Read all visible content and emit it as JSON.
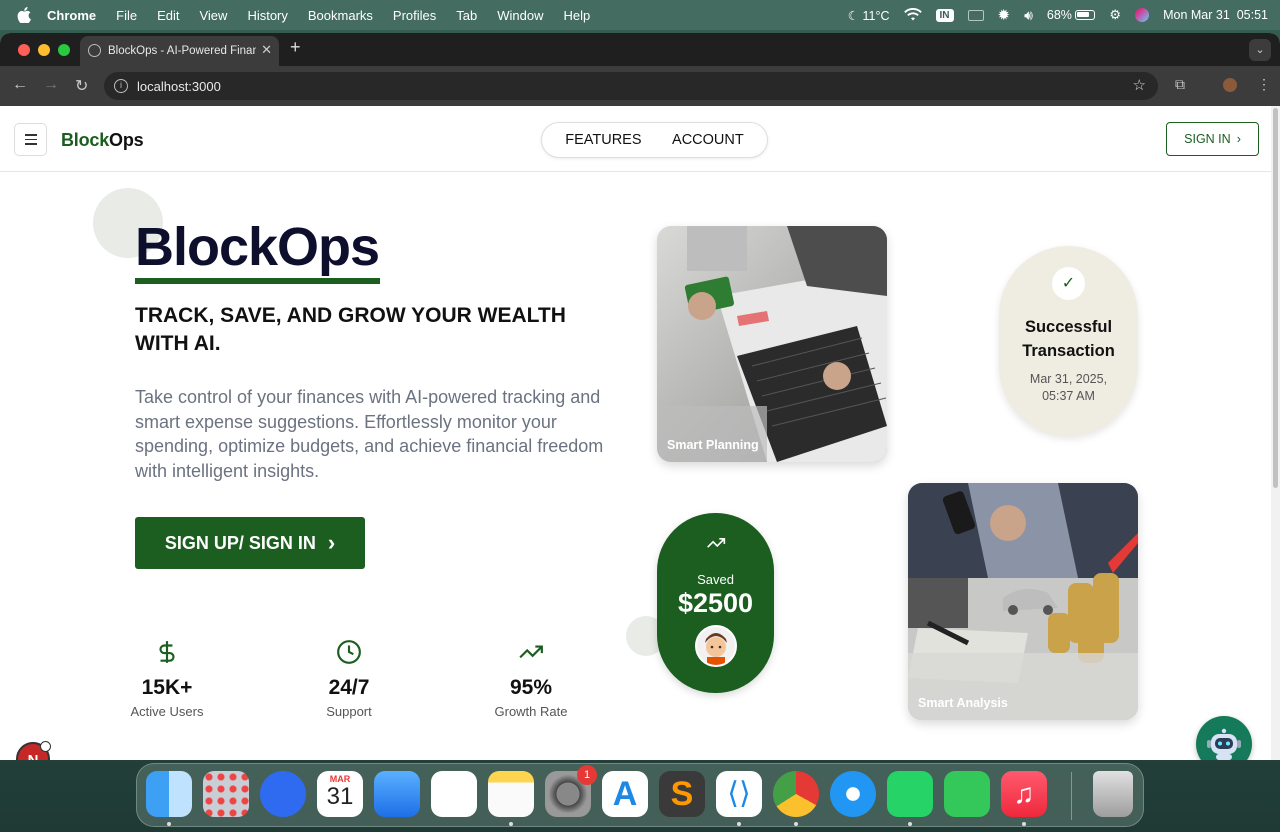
{
  "menubar": {
    "app_name": "Chrome",
    "items": [
      "File",
      "Edit",
      "View",
      "History",
      "Bookmarks",
      "Profiles",
      "Tab",
      "Window",
      "Help"
    ],
    "weather": "11°C",
    "input_source": "IN",
    "battery": "68%",
    "clock": "Mon Mar 31  05:51"
  },
  "browser": {
    "tab_title": "BlockOps - AI-Powered Finan",
    "url": "localhost:3000"
  },
  "site": {
    "logo_block": "Block",
    "logo_ops": "Ops",
    "nav": [
      "FEATURES",
      "ACCOUNT"
    ],
    "signin_label": "SIGN IN"
  },
  "hero": {
    "title": "BlockOps",
    "subtitle": "TRACK, SAVE, AND GROW YOUR WEALTH WITH AI.",
    "description": "Take control of your finances with AI-powered tracking and smart expense suggestions. Effortlessly monitor your spending, optimize budgets, and achieve financial freedom with intelligent insights.",
    "cta": "SIGN UP/ SIGN IN"
  },
  "stats": [
    {
      "value": "15K+",
      "label": "Active Users",
      "icon": "dollar-icon"
    },
    {
      "value": "24/7",
      "label": "Support",
      "icon": "clock-icon"
    },
    {
      "value": "95%",
      "label": "Growth Rate",
      "icon": "trending-up-icon"
    }
  ],
  "cards": {
    "planning_caption": "Smart Planning",
    "analysis_caption": "Smart Analysis",
    "success_title": "Successful Transaction",
    "success_date": "Mar 31, 2025, 05:37 AM",
    "saved_label": "Saved",
    "saved_amount": "$2500"
  },
  "notification_letter": "N",
  "dock": {
    "calendar_month": "MAR",
    "calendar_day": "31",
    "settings_badge": "1",
    "apps": [
      "Finder",
      "Launchpad",
      "Screen Time",
      "Calendar",
      "Mail",
      "Reminders",
      "Notes",
      "System Settings",
      "App Store",
      "Sublime Text",
      "VS Code",
      "Chrome",
      "Safari",
      "WhatsApp",
      "FaceTime",
      "Music",
      "Trash"
    ]
  },
  "colors": {
    "brand_green": "#1b5e20",
    "navy": "#0e0f2c",
    "success_bg": "#efede2"
  }
}
